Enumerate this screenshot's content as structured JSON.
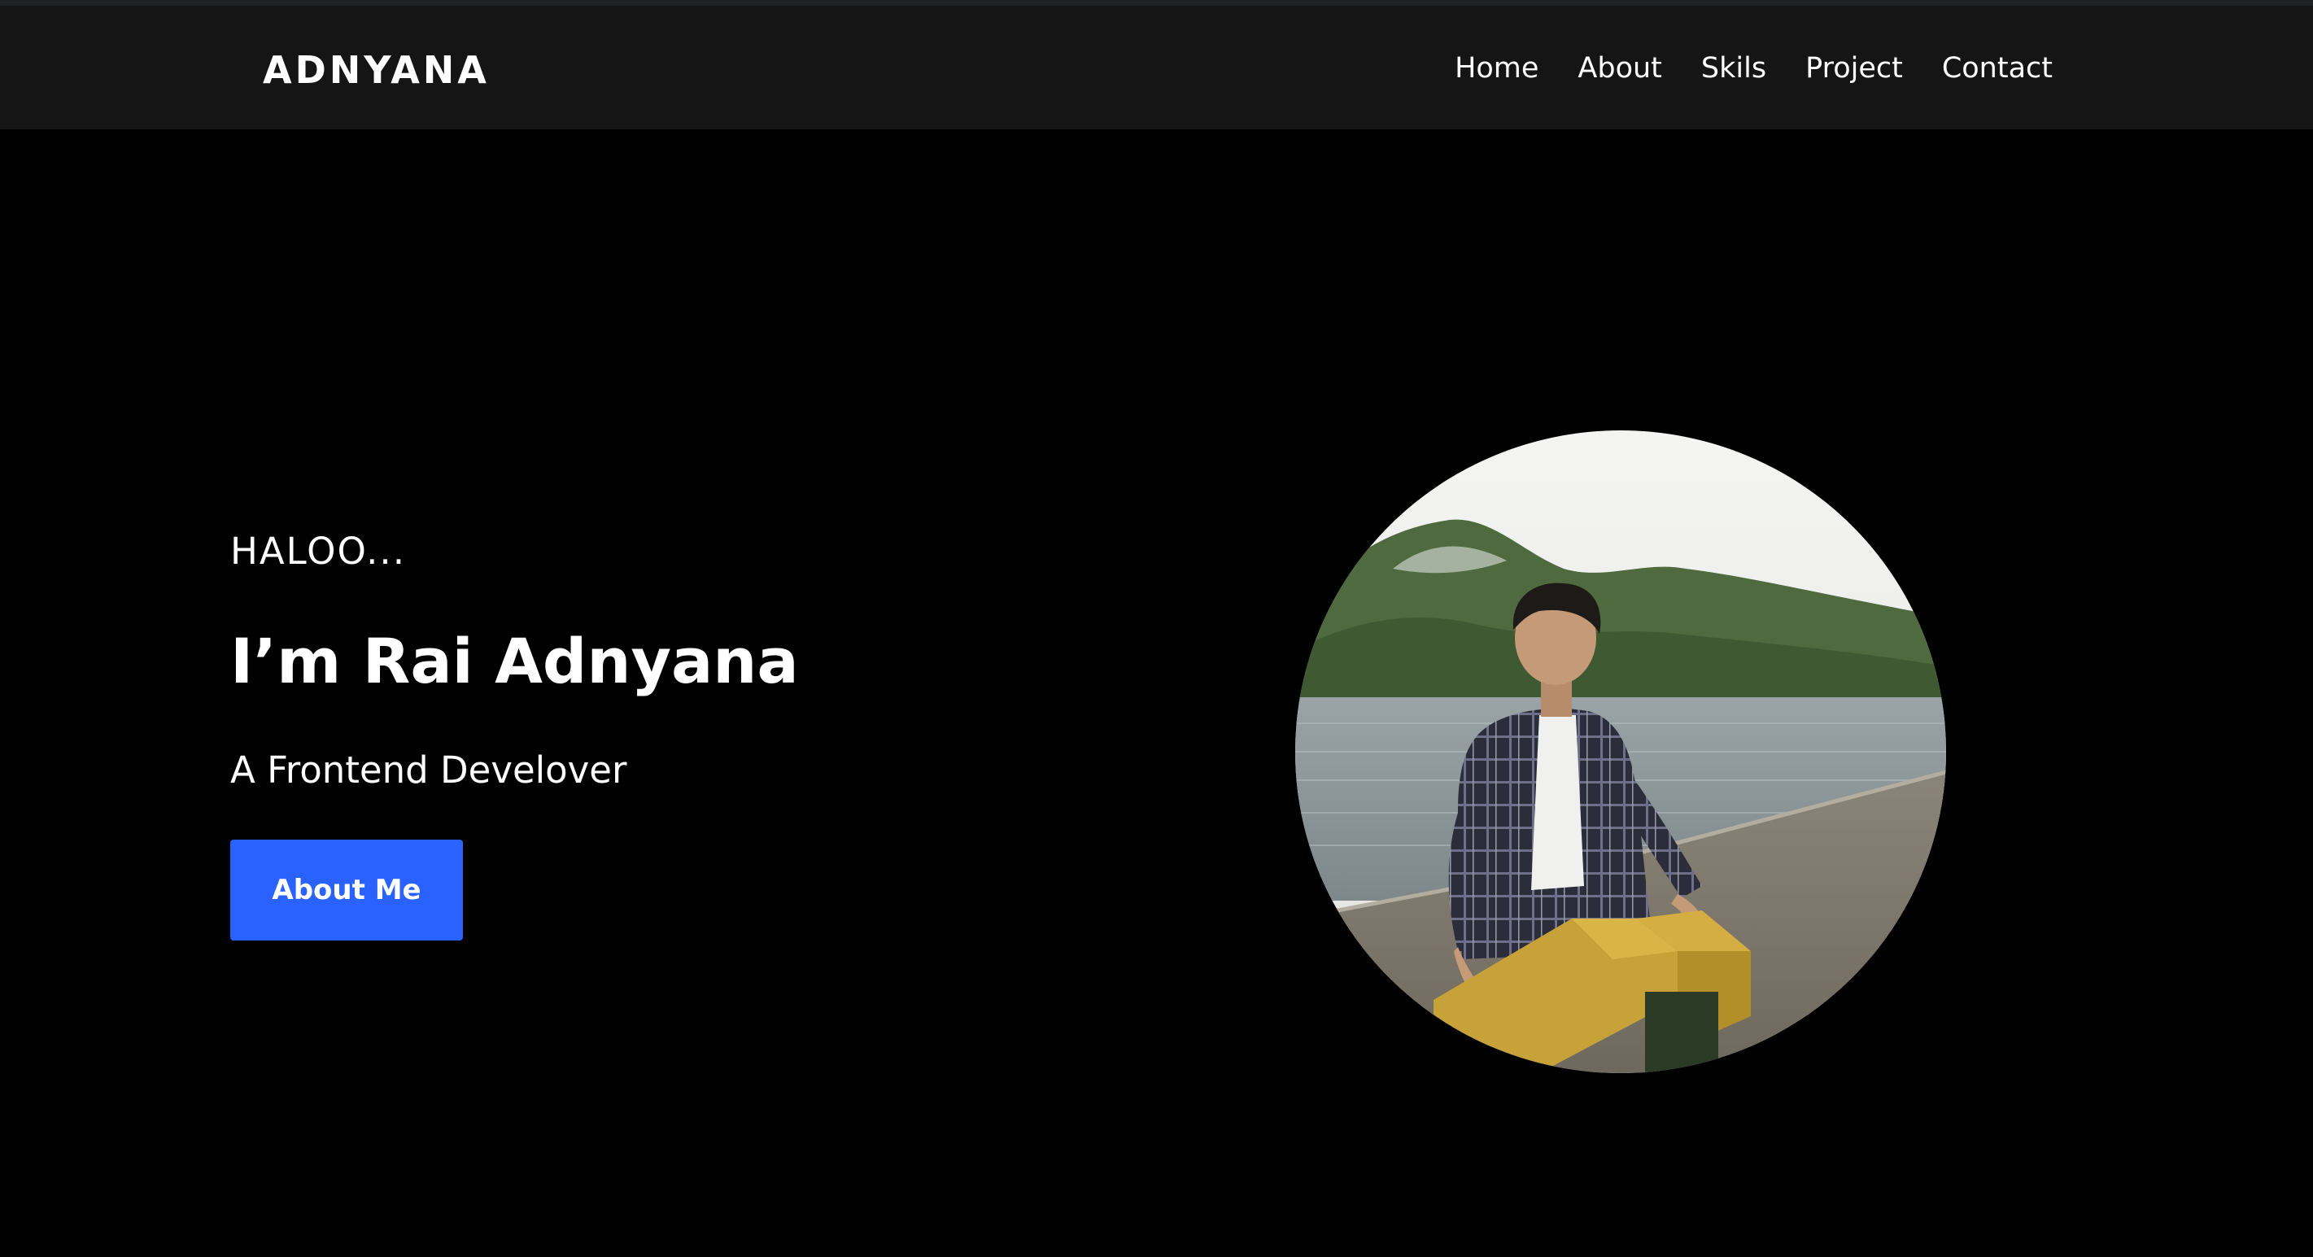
{
  "brand": {
    "name": "ADNYANA"
  },
  "nav": {
    "items": [
      "Home",
      "About",
      "Skils",
      "Project",
      "Contact"
    ]
  },
  "hero": {
    "greeting": "HALOO...",
    "name": "I’m Rai Adnyana",
    "role": "A Frontend Develover",
    "button_label": "About Me"
  },
  "colors": {
    "background": "#000000",
    "navbar": "#151515",
    "accent": "#2962ff",
    "text": "#ffffff"
  }
}
